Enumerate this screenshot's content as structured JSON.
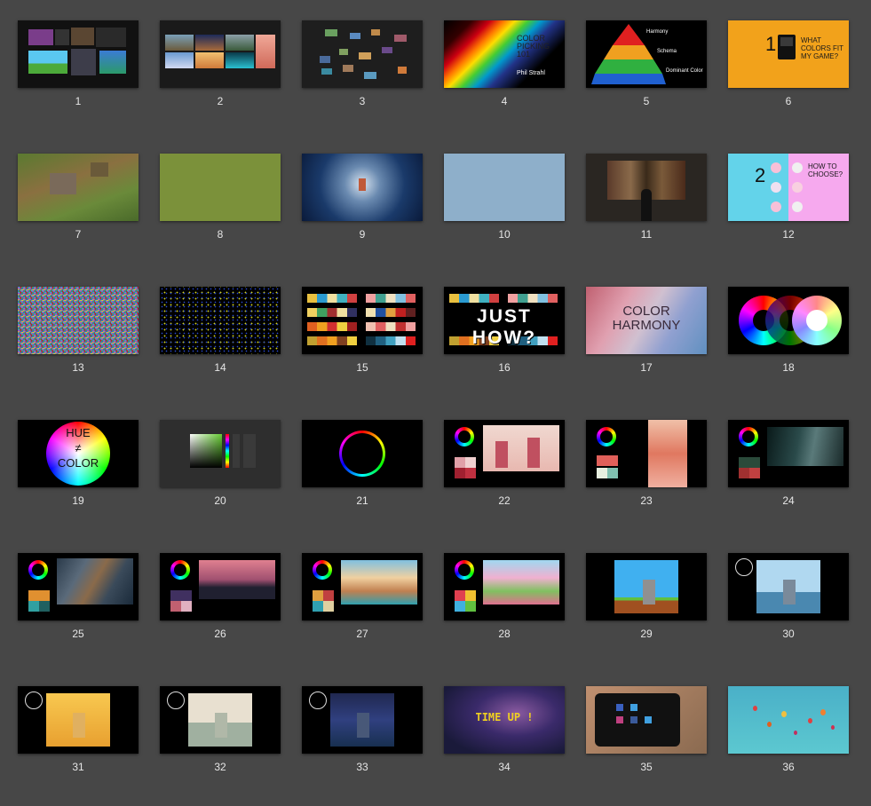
{
  "slides": [
    {
      "number": "1"
    },
    {
      "number": "2"
    },
    {
      "number": "3"
    },
    {
      "number": "4",
      "title": "COLOR PICKING 101",
      "author": "Phil Strahl"
    },
    {
      "number": "5",
      "labels": [
        "Harmony",
        "Schema",
        "Dominant Color"
      ]
    },
    {
      "number": "6",
      "digit": "1",
      "question": "WHAT COLORS FIT MY GAME?"
    },
    {
      "number": "7"
    },
    {
      "number": "8"
    },
    {
      "number": "9"
    },
    {
      "number": "10"
    },
    {
      "number": "11"
    },
    {
      "number": "12",
      "digit": "2",
      "question": "HOW TO CHOOSE?"
    },
    {
      "number": "13"
    },
    {
      "number": "14"
    },
    {
      "number": "15"
    },
    {
      "number": "16",
      "overlay": "JUST HOW?"
    },
    {
      "number": "17",
      "title": "COLOR HARMONY"
    },
    {
      "number": "18"
    },
    {
      "number": "19",
      "line1": "HUE",
      "line2": "≠",
      "line3": "COLOR"
    },
    {
      "number": "20"
    },
    {
      "number": "21"
    },
    {
      "number": "22"
    },
    {
      "number": "23"
    },
    {
      "number": "24"
    },
    {
      "number": "25"
    },
    {
      "number": "26"
    },
    {
      "number": "27"
    },
    {
      "number": "28"
    },
    {
      "number": "29"
    },
    {
      "number": "30"
    },
    {
      "number": "31"
    },
    {
      "number": "32"
    },
    {
      "number": "33"
    },
    {
      "number": "34",
      "text": "TIME UP !"
    },
    {
      "number": "35"
    },
    {
      "number": "36"
    }
  ],
  "colors": {
    "background": "#474747",
    "slide6": "#f2a21b",
    "slide8": "#7b913a",
    "slide10": "#8eafca",
    "slide12a": "#63d3ea",
    "slide12b": "#f6a9ee"
  }
}
